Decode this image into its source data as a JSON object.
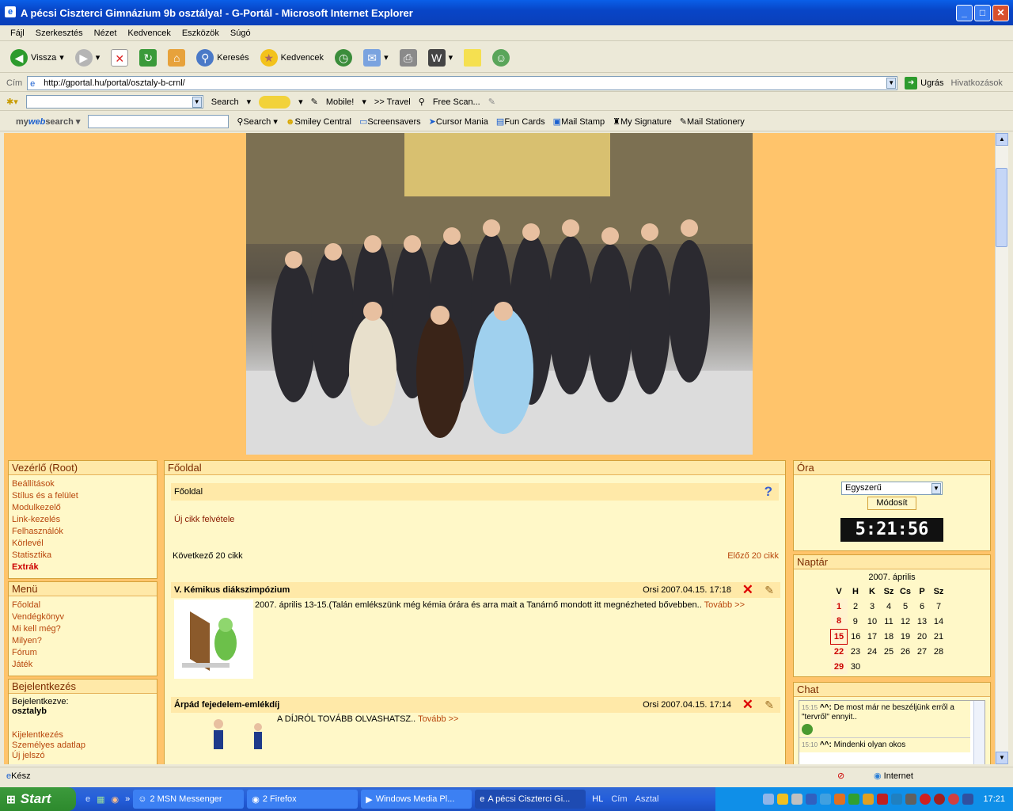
{
  "window": {
    "title": "A pécsi Ciszterci Gimnázium 9b osztálya! - G-Portál - Microsoft Internet Explorer"
  },
  "menu": [
    "Fájl",
    "Szerkesztés",
    "Nézet",
    "Kedvencek",
    "Eszközök",
    "Súgó"
  ],
  "toolbar": {
    "back": "Vissza",
    "search": "Keresés",
    "favorites": "Kedvencek"
  },
  "address": {
    "label": "Cím",
    "url": "http://gportal.hu/portal/osztaly-b-crnl/",
    "go": "Ugrás",
    "links": "Hivatkozások"
  },
  "toolbar2": {
    "search": "Search",
    "mobile": "Mobile!",
    "travel": ">> Travel",
    "freescan": "Free Scan..."
  },
  "toolbar3": {
    "brand_a": "my",
    "brand_b": "web",
    "brand_c": "search",
    "search": "Search",
    "items": [
      "Smiley Central",
      "Screensavers",
      "Cursor Mania",
      "Fun Cards",
      "Mail Stamp",
      "My Signature",
      "Mail Stationery"
    ]
  },
  "left": {
    "root_title": "Vezérlő (Root)",
    "root_items": [
      "Beállítások",
      "Stílus és a felület",
      "Modulkezelő",
      "Link-kezelés",
      "Felhasználók",
      "Körlevél",
      "Statisztika"
    ],
    "extras": "Extrák",
    "menu_title": "Menü",
    "menu_items": [
      "Főoldal",
      "Vendégkönyv",
      "Mi kell még?",
      "Milyen?",
      "Fórum",
      "Játék"
    ],
    "login_title": "Bejelentkezés",
    "logged_in_label": "Bejelentkezve:",
    "username": "osztalyb",
    "login_items": [
      "Kijelentkezés",
      "Személyes adatlap",
      "Új jelszó"
    ]
  },
  "main": {
    "title": "Főoldal",
    "subtitle": "Főoldal",
    "help": "?",
    "new_article": "Új cikk felvétele",
    "next": "Következő 20 cikk",
    "prev": "Előző 20 cikk",
    "articles": [
      {
        "title": "V. Kémikus diákszimpózium",
        "author": "Orsi",
        "date": "2007.04.15. 17:18",
        "body": "2007. április 13-15.(Talán emlékszünk még kémia órára és arra mait a Tanárnő mondott itt megnézheted bővebben..",
        "more": "Tovább >>"
      },
      {
        "title": "Árpád fejedelem-emlékdíj",
        "author": "Orsi",
        "date": "2007.04.15. 17:14",
        "body": "A DÍJRÓL TOVÁBB OLVASHATSZ..",
        "more": "Tovább >>"
      }
    ]
  },
  "right": {
    "clock_title": "Óra",
    "clock_select": "Egyszerű",
    "clock_button": "Módosít",
    "clock_time": "5:21:56",
    "cal_title": "Naptár",
    "cal_month": "2007. április",
    "cal_head": [
      "V",
      "H",
      "K",
      "Sz",
      "Cs",
      "P",
      "Sz"
    ],
    "cal_rows": [
      [
        "1",
        "2",
        "3",
        "4",
        "5",
        "6",
        "7"
      ],
      [
        "8",
        "9",
        "10",
        "11",
        "12",
        "13",
        "14"
      ],
      [
        "15",
        "16",
        "17",
        "18",
        "19",
        "20",
        "21"
      ],
      [
        "22",
        "23",
        "24",
        "25",
        "26",
        "27",
        "28"
      ],
      [
        "29",
        "30",
        "",
        "",
        "",
        "",
        ""
      ]
    ],
    "chat_title": "Chat",
    "chat": [
      {
        "time": "15:15",
        "nick": "^^:",
        "text": "De most már ne beszéljünk erről a \"tervről\" ennyit.."
      },
      {
        "time": "15:10",
        "nick": "^^:",
        "text": "Mindenki olyan okos"
      }
    ]
  },
  "status": {
    "text": "Kész",
    "zone": "Internet"
  },
  "taskbar": {
    "start": "Start",
    "tasks": [
      "2 MSN Messenger",
      "2 Firefox",
      "Windows Media Pl...",
      "A pécsi Ciszterci Gi..."
    ],
    "lang": "HL",
    "quick": [
      "Cím",
      "Asztal"
    ],
    "time": "17:21"
  },
  "colors": {
    "accent": "#b8460c",
    "panel": "#fff8c8",
    "page": "#ffc46b"
  }
}
